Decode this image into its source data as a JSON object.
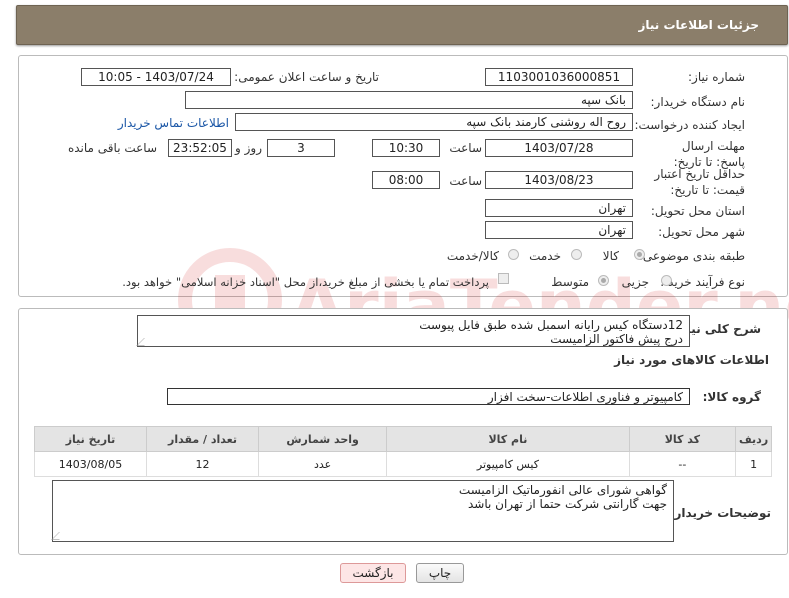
{
  "header": {
    "title": "جزئیات اطلاعات نیاز"
  },
  "form": {
    "need_number_label": "شماره نیاز:",
    "need_number": "1103001036000851",
    "announce_label": "تاریخ و ساعت اعلان عمومی:",
    "announce_value": "1403/07/24 - 10:05",
    "buyer_org_label": "نام دستگاه خریدار:",
    "buyer_org": "بانک سپه",
    "requester_label": "ایجاد کننده درخواست:",
    "requester": "روح اله روشنی کارمند بانک سپه",
    "contact_link": "اطلاعات تماس خریدار",
    "deadline_label": "مهلت ارسال پاسخ: تا تاریخ:",
    "deadline_date": "1403/07/28",
    "time_label": "ساعت",
    "deadline_time": "10:30",
    "days_value": "3",
    "days_label": "روز و",
    "remaining_time": "23:52:05",
    "remaining_label": "ساعت باقی مانده",
    "validity_label": "حداقل تاریخ اعتبار قیمت: تا تاریخ:",
    "validity_date": "1403/08/23",
    "validity_time": "08:00",
    "province_label": "استان محل تحویل:",
    "province": "تهران",
    "city_label": "شهر محل تحویل:",
    "city": "تهران",
    "category_label": "طبقه بندی موضوعی:",
    "category_options": [
      "کالا",
      "خدمت",
      "کالا/خدمت"
    ],
    "category_selected": "کالا",
    "purchase_type_label": "نوع فرآیند خرید :",
    "purchase_options": [
      "جزیی",
      "متوسط"
    ],
    "purchase_note": "پرداخت تمام یا بخشی از مبلغ خرید،از محل \"اسناد خزانه اسلامی\" خواهد بود."
  },
  "details": {
    "description_label": "شرح کلی نیاز:",
    "description": "12دستگاه کیس رایانه اسمبل شده طبق فایل پیوست\nدرج پیش فاکتور الزامیست",
    "goods_info_title": "اطلاعات کالاهای مورد نیاز",
    "group_label": "گروه کالا:",
    "group_value": "کامپیوتر و فناوری اطلاعات-سخت افزار",
    "table_headers": [
      "ردیف",
      "کد کالا",
      "نام کالا",
      "واحد شمارش",
      "تعداد / مقدار",
      "تاریخ نیاز"
    ],
    "table_rows": [
      [
        "1",
        "--",
        "کیس کامپیوتر",
        "عدد",
        "12",
        "1403/08/05"
      ]
    ],
    "buyer_notes_label": "توضیحات خریدار:",
    "buyer_notes": "گواهی شورای عالی انفورماتیک الزامیست\nجهت گارانتی شرکت حتما از تهران باشد"
  },
  "buttons": {
    "print": "چاپ",
    "back": "بازگشت"
  },
  "watermark": {
    "text": "AriaTender.neT"
  }
}
